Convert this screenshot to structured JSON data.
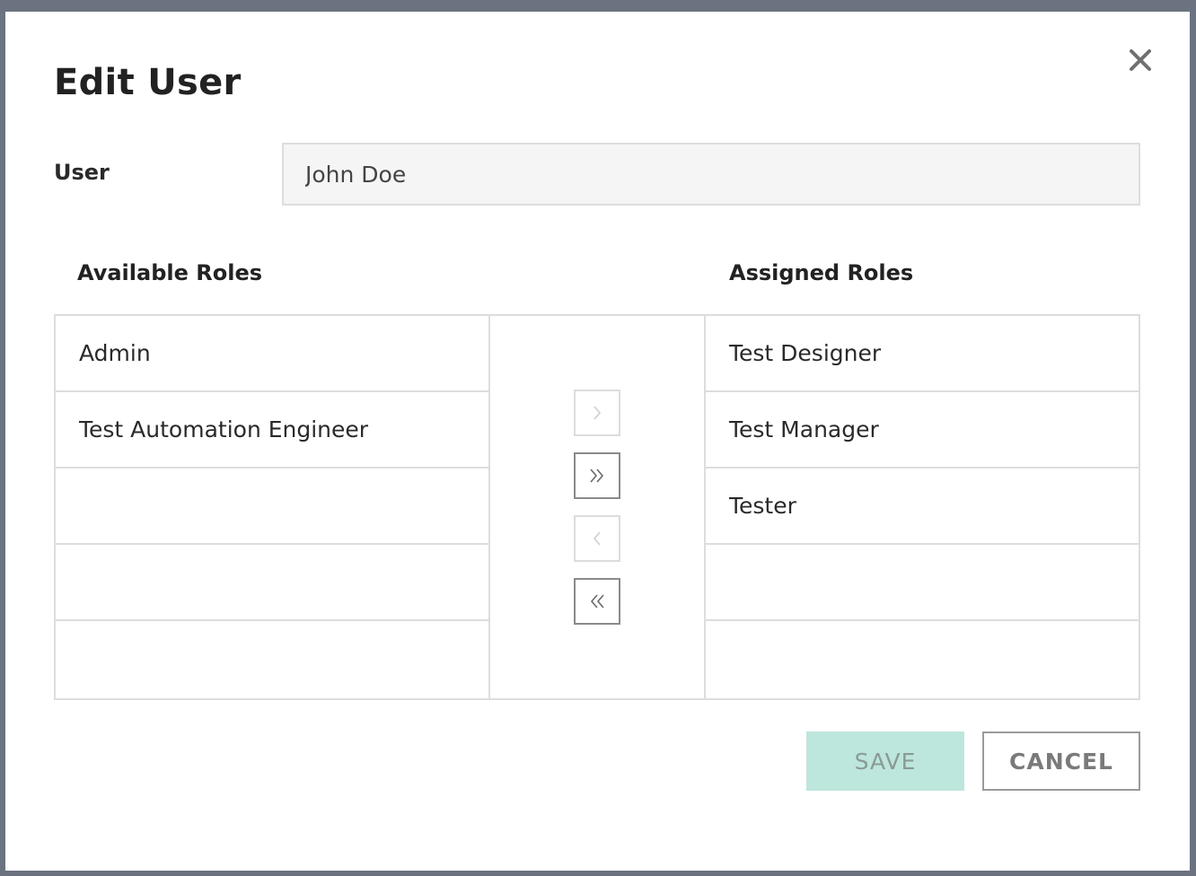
{
  "dialog": {
    "title": "Edit User",
    "user_label": "User",
    "user_value": "John Doe"
  },
  "roles": {
    "available_header": "Available Roles",
    "assigned_header": "Assigned Roles",
    "available": [
      "Admin",
      "Test Automation Engineer",
      "",
      "",
      ""
    ],
    "assigned": [
      "Test Designer",
      "Test Manager",
      "Tester",
      "",
      ""
    ]
  },
  "transfer_controls": [
    {
      "icon": "chevron-right-icon",
      "state": "disabled"
    },
    {
      "icon": "double-chevron-right-icon",
      "state": "enabled"
    },
    {
      "icon": "chevron-left-icon",
      "state": "disabled"
    },
    {
      "icon": "double-chevron-left-icon",
      "state": "enabled"
    }
  ],
  "actions": {
    "save_label": "SAVE",
    "cancel_label": "CANCEL"
  },
  "colors": {
    "save_bg": "#bde6dc",
    "frame_border": "#6b7280",
    "list_border": "#dddddd"
  },
  "icons": {
    "close": "close-icon"
  }
}
